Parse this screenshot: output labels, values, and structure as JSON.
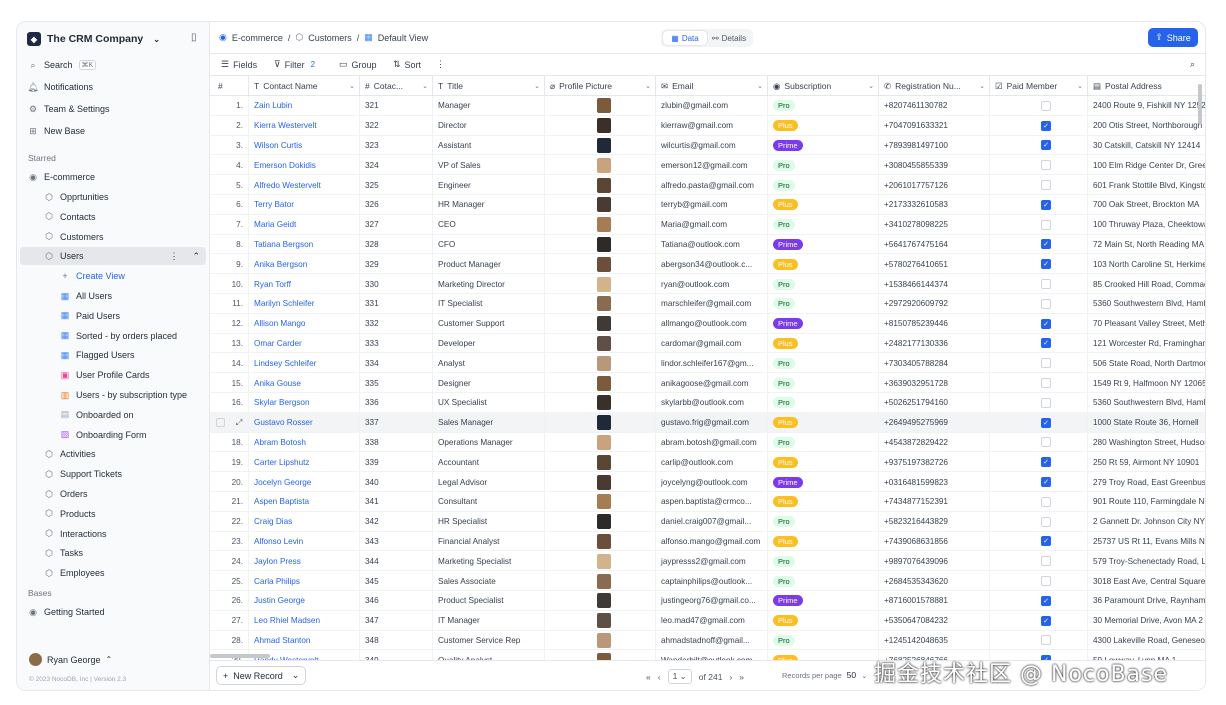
{
  "app": {
    "workspace": "The CRM Company"
  },
  "sidebar": {
    "top": [
      {
        "icon": "search-icon",
        "label": "Search",
        "kbd": "⌘K"
      },
      {
        "icon": "bell-icon",
        "label": "Notifications"
      },
      {
        "icon": "gear-icon",
        "label": "Team & Settings"
      },
      {
        "icon": "plus-square-icon",
        "label": "New Base"
      }
    ],
    "starred_label": "Starred",
    "base": "E-commerce",
    "tables": [
      "Opprtunities",
      "Contacts",
      "Customers",
      "Users"
    ],
    "create_view": "Create View",
    "views": [
      {
        "icon": "grid-icon",
        "label": "All Users"
      },
      {
        "icon": "grid-icon",
        "label": "Paid Users"
      },
      {
        "icon": "grid-icon",
        "label": "Sorted - by orders placed"
      },
      {
        "icon": "grid-icon",
        "label": "Flagged Users"
      },
      {
        "icon": "gallery-icon",
        "label": "User Profile Cards"
      },
      {
        "icon": "kanban-icon",
        "label": "Users - by subscription type"
      },
      {
        "icon": "calendar-icon",
        "label": "Onboarded on"
      },
      {
        "icon": "form-icon",
        "label": "Onboarding Form"
      }
    ],
    "tables2": [
      "Activities",
      "Support Tickets",
      "Orders",
      "Products",
      "Interactions",
      "Tasks",
      "Employees"
    ],
    "bases_label": "Bases",
    "base2": "Getting Started",
    "user": "Ryan George",
    "copyright": "© 2023 NocoDB, Inc | Version 2.3"
  },
  "topbar": {
    "crumbs": [
      "E-commerce",
      "Customers",
      "Default View"
    ],
    "tab_data": "Data",
    "tab_details": "Details",
    "share": "Share"
  },
  "toolbar": {
    "fields": "Fields",
    "filter": "Filter",
    "filter_count": "2",
    "group": "Group",
    "sort": "Sort"
  },
  "columns": [
    "#",
    "Contact Name",
    "Cotac...",
    "Title",
    "Profile Picture",
    "Email",
    "Subscription",
    "Registration Nu...",
    "Paid Member",
    "Postal Address"
  ],
  "rows": [
    [
      "1.",
      "Zain Lubin",
      "321",
      "Manager",
      "zlubin@gmail.com",
      "Pro",
      "+8207461130782",
      false,
      "2400 Route 9, Fishkill NY 12524"
    ],
    [
      "2.",
      "Kierra Westervelt",
      "322",
      "Director",
      "kierraw@gmail.com",
      "Plus",
      "+7047091633321",
      true,
      "200 Otis Street, Northborough"
    ],
    [
      "3.",
      "Wilson Curtis",
      "323",
      "Assistant",
      "wilcurtis@gmail.com",
      "Prime",
      "+7893981497100",
      true,
      "30 Catskill, Catskill NY 12414"
    ],
    [
      "4.",
      "Emerson Dokidis",
      "324",
      "VP of Sales",
      "emerson12@gmail.com",
      "Pro",
      "+3080455855339",
      false,
      "100 Elm Ridge Center Dr, Greece"
    ],
    [
      "5.",
      "Alfredo Westervelt",
      "325",
      "Engineer",
      "alfredo.pasta@gmail.com",
      "Pro",
      "+2061017757126",
      false,
      "601 Frank Stottile Blvd, Kingston"
    ],
    [
      "6.",
      "Terry Bator",
      "326",
      "HR Manager",
      "terryb@gmail.com",
      "Plus",
      "+2173332610583",
      true,
      "700 Oak Street, Brockton MA"
    ],
    [
      "7.",
      "Maria Geidt",
      "327",
      "CEO",
      "Maria@gmail.com",
      "Pro",
      "+3410278098225",
      false,
      "100 Thruway Plaza, Cheektowaga"
    ],
    [
      "8.",
      "Tatiana Bergson",
      "328",
      "CFO",
      "Tatiana@outlook.com",
      "Prime",
      "+5641767475164",
      true,
      "72 Main St, North Reading MA"
    ],
    [
      "9.",
      "Anika Bergson",
      "329",
      "Product Manager",
      "abergson34@outlook.c...",
      "Plus",
      "+5780276410651",
      true,
      "103 North Caroline St, Herkimer"
    ],
    [
      "10.",
      "Ryan Torff",
      "330",
      "Marketing Director",
      "ryan@outlook.com",
      "Pro",
      "+1538466144374",
      false,
      "85 Crooked Hill Road, Commack"
    ],
    [
      "11.",
      "Marilyn Schleifer",
      "331",
      "IT Specialist",
      "marschleifer@gmail.com",
      "Pro",
      "+2972920609792",
      false,
      "5360 Southwestern Blvd, Hamburg"
    ],
    [
      "12.",
      "Allison Mango",
      "332",
      "Customer Support",
      "allmango@outlook.com",
      "Prime",
      "+8150785239446",
      true,
      "70 Pleasant Valley Street, Methuen"
    ],
    [
      "13.",
      "Omar Carder",
      "333",
      "Developer",
      "cardomar@gmail.com",
      "Plus",
      "+2482177130336",
      true,
      "121 Worcester Rd, Framingham"
    ],
    [
      "14.",
      "Lindsey Schleifer",
      "334",
      "Analyst",
      "lindor.schleifer167@gm...",
      "Pro",
      "+7303405788284",
      false,
      "506 State Road, North Dartmouth"
    ],
    [
      "15.",
      "Anika Gouse",
      "335",
      "Designer",
      "anikagoose@gmail.com",
      "Pro",
      "+3639032951728",
      false,
      "1549 Rt 9, Halfmoon NY 12065"
    ],
    [
      "16.",
      "Skylar Bergson",
      "336",
      "UX Specialist",
      "skylarbb@outlook.com",
      "Pro",
      "+5026251794160",
      false,
      "5360 Southwestern Blvd, Hamburg"
    ],
    [
      "",
      "Gustavo Rosser",
      "337",
      "Sales Manager",
      "gustavo.frig@gmail.com",
      "Plus",
      "+2649495275969",
      true,
      "1000 State Route 36, Hornell"
    ],
    [
      "18.",
      "Abram Botosh",
      "338",
      "Operations Manager",
      "abram.botosh@gmail.com",
      "Pro",
      "+4543872829422",
      false,
      "280 Washington Street, Hudson"
    ],
    [
      "19.",
      "Carter Lipshutz",
      "339",
      "Accountant",
      "carlip@outlook.com",
      "Plus",
      "+9375197382726",
      true,
      "250 Rt 59, Airmont NY 10901"
    ],
    [
      "20.",
      "Jocelyn George",
      "340",
      "Legal Advisor",
      "joycelyng@outlook.com",
      "Prime",
      "+0316481599823",
      true,
      "279 Troy Road, East Greenbush"
    ],
    [
      "21.",
      "Aspen Baptista",
      "341",
      "Consultant",
      "aspen.baptista@crmco...",
      "Plus",
      "+7434877152391",
      false,
      "901 Route 110, Farmingdale NY"
    ],
    [
      "22.",
      "Craig Dias",
      "342",
      "HR Specialist",
      "daniel.craig007@gmail...",
      "Pro",
      "+5823216443829",
      false,
      "2 Gannett Dr. Johnson City NY"
    ],
    [
      "23.",
      "Alfonso Levin",
      "343",
      "Financial Analyst",
      "alfonso.mango@gmail.com",
      "Plus",
      "+7439068631856",
      true,
      "25737 US Rt 11, Evans Mills NY"
    ],
    [
      "24.",
      "Jaylon Press",
      "344",
      "Marketing Specialist",
      "jaypresss2@gmail.com",
      "Pro",
      "+9897076439096",
      false,
      "579 Troy-Schenectady Road, Latham"
    ],
    [
      "25.",
      "Carla Philips",
      "345",
      "Sales Associate",
      "captainphilips@outlook...",
      "Pro",
      "+2684535343620",
      false,
      "3018 East Ave, Central Square"
    ],
    [
      "26.",
      "Justin George",
      "346",
      "Product Specialist",
      "justingeorg76@gmail.co...",
      "Prime",
      "+8716001578881",
      true,
      "36 Paramount Drive, Raynham"
    ],
    [
      "27.",
      "Leo Rhiel Madsen",
      "347",
      "IT Manager",
      "leo.mad47@gmail.com",
      "Plus",
      "+5350647084232",
      true,
      "30 Memorial Drive, Avon MA 2"
    ],
    [
      "28.",
      "Ahmad Stanton",
      "348",
      "Customer Service Rep",
      "ahmadstadnoff@gmail...",
      "Pro",
      "+1245142048635",
      false,
      "4300 Lakeville Road, Geneseo"
    ],
    [
      "29.",
      "Randy Westervelt",
      "349",
      "Quality Analyst",
      "Wanderbilt@outlook.com",
      "Plus",
      "+7682526846766",
      true,
      "59 Lowway, Lynn MA 1"
    ]
  ],
  "footer": {
    "new_record": "New Record",
    "page": "1",
    "of": "of 241",
    "records_per_page": "Records per page",
    "per_page": "50"
  },
  "watermark": "掘金技术社区 @ NocoBase",
  "colors": {
    "accent": "#2563eb",
    "pro": "#dcfce7",
    "plus": "#fbbf24",
    "prime": "#7c3aed"
  }
}
